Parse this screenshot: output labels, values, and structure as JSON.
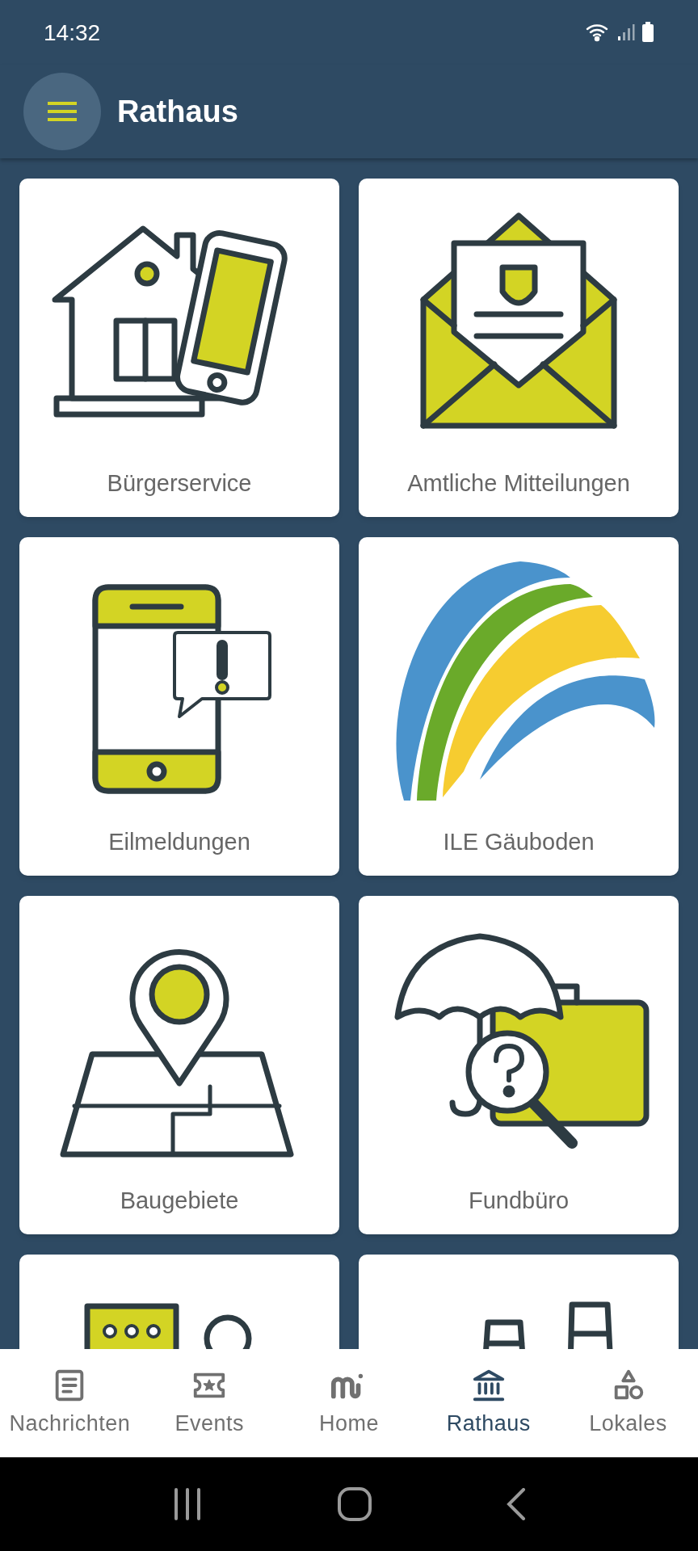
{
  "status_bar": {
    "time": "14:32"
  },
  "app_bar": {
    "title": "Rathaus"
  },
  "tiles": [
    {
      "kind": "house-phone",
      "label": "Bürgerservice"
    },
    {
      "kind": "envelope",
      "label": "Amtliche Mitteilungen"
    },
    {
      "kind": "phone-alert",
      "label": "Eilmeldungen"
    },
    {
      "kind": "rainbow",
      "label": "ILE Gäuboden"
    },
    {
      "kind": "map-pin",
      "label": "Baugebiete"
    },
    {
      "kind": "lost-found",
      "label": "Fundbüro"
    },
    {
      "kind": "chat-person"
    },
    {
      "kind": "chairs"
    }
  ],
  "bottom_nav": [
    {
      "kind": "news",
      "label": "Nachrichten",
      "selected": false
    },
    {
      "kind": "ticket",
      "label": "Events",
      "selected": false
    },
    {
      "kind": "home",
      "label": "Home",
      "selected": false
    },
    {
      "kind": "townhall",
      "label": "Rathaus",
      "selected": true
    },
    {
      "kind": "shapes",
      "label": "Lokales",
      "selected": false
    }
  ]
}
